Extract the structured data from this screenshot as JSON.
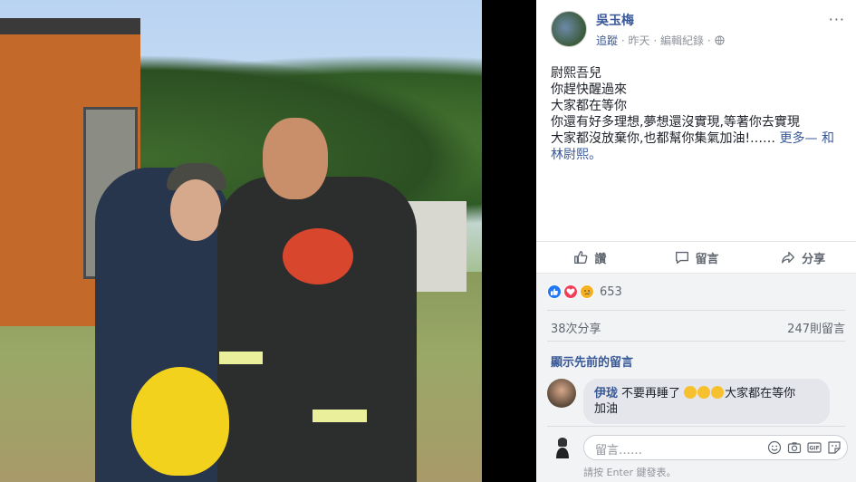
{
  "post": {
    "author": "吳玉梅",
    "follow_label": "追蹤",
    "separator": "·",
    "time": "昨天",
    "edit_history": "編輯紀錄",
    "more_menu": "···",
    "text_lines": [
      "尉熙吾兒",
      "你趕快醒過來",
      "大家都在等你",
      "你還有好多理想,夢想還沒實現,等著你去實現",
      "大家都沒放棄你,也都幫你集氣加油!……"
    ],
    "see_more": "更多",
    "tag_dash": "— 和",
    "tagged": "林尉熙。"
  },
  "actions": {
    "like": "讚",
    "comment": "留言",
    "share": "分享"
  },
  "stats": {
    "reaction_count": "653",
    "shares": "38次分享",
    "comments": "247則留言",
    "view_previous": "顯示先前的留言"
  },
  "comment": {
    "name": "伊珑",
    "text_part1": "不要再睡了",
    "text_part2": "大家都在等你",
    "text_part3": "加油"
  },
  "composer": {
    "placeholder": "留言……",
    "hint": "請按 Enter 鍵發表。"
  },
  "colors": {
    "link": "#385898",
    "like": "#2078f4",
    "love": "#f33e58",
    "sad": "#f7b125"
  },
  "icons": [
    "globe-icon",
    "thumbs-up-icon",
    "comment-icon",
    "share-icon",
    "emoji-icon",
    "camera-icon",
    "gif-icon",
    "sticker-icon"
  ]
}
